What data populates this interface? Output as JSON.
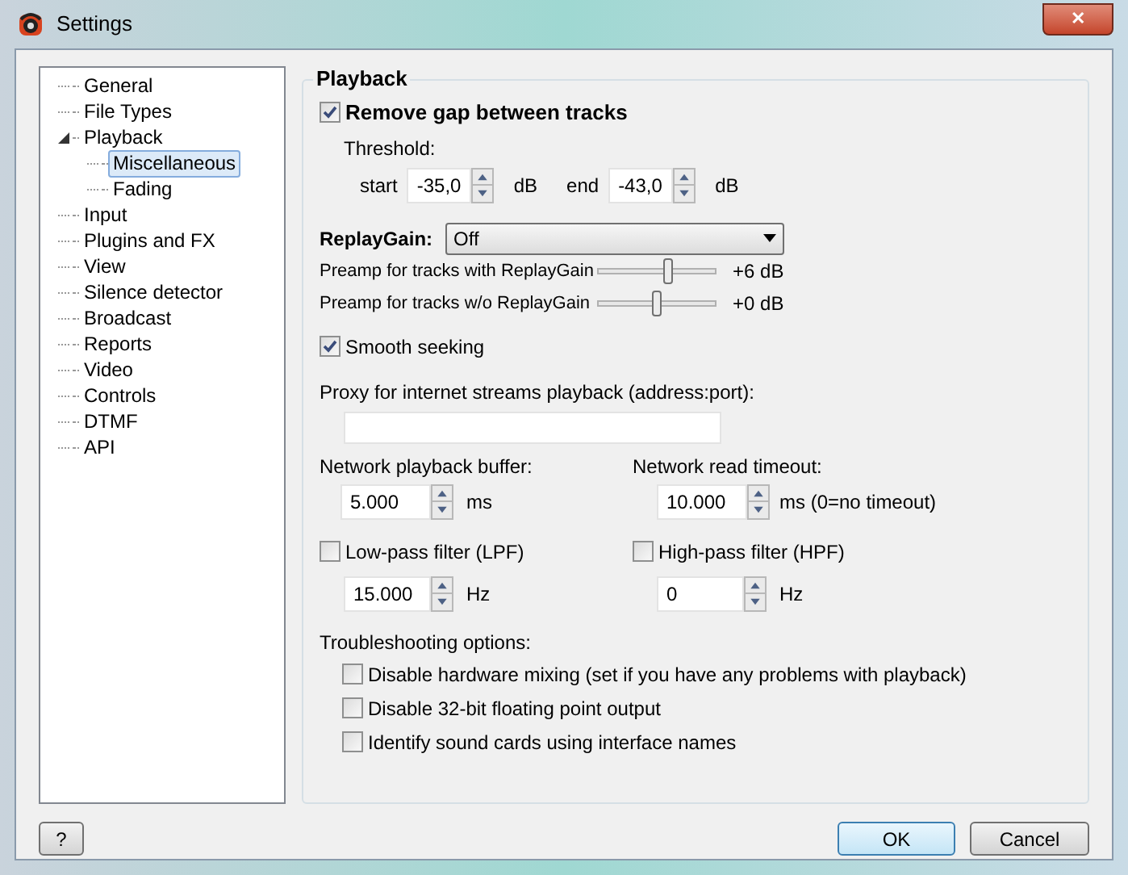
{
  "window": {
    "title": "Settings",
    "close": "✕"
  },
  "tree": [
    {
      "label": "General",
      "selected": false
    },
    {
      "label": "File Types",
      "selected": false
    },
    {
      "label": "Playback",
      "selected": false,
      "expanded": true,
      "children": [
        {
          "label": "Miscellaneous",
          "selected": true
        },
        {
          "label": "Fading",
          "selected": false
        }
      ]
    },
    {
      "label": "Input",
      "selected": false
    },
    {
      "label": "Plugins and FX",
      "selected": false
    },
    {
      "label": "View",
      "selected": false
    },
    {
      "label": "Silence detector",
      "selected": false
    },
    {
      "label": "Broadcast",
      "selected": false
    },
    {
      "label": "Reports",
      "selected": false
    },
    {
      "label": "Video",
      "selected": false
    },
    {
      "label": "Controls",
      "selected": false
    },
    {
      "label": "DTMF",
      "selected": false
    },
    {
      "label": "API",
      "selected": false
    }
  ],
  "group": {
    "title": "Playback",
    "remove_gap": {
      "label": "Remove gap between tracks",
      "checked": true
    },
    "threshold": {
      "label": "Threshold:",
      "start": {
        "label": "start",
        "value": "-35,0",
        "unit": "dB"
      },
      "end": {
        "label": "end",
        "value": "-43,0",
        "unit": "dB"
      }
    },
    "replaygain": {
      "label": "ReplayGain:",
      "value": "Off"
    },
    "preamps": [
      {
        "label": "Preamp for tracks with ReplayGain",
        "level": 0.6,
        "reading": "+6 dB"
      },
      {
        "label": "Preamp for tracks w/o ReplayGain",
        "level": 0.5,
        "reading": "+0 dB"
      }
    ],
    "smooth_seeking": {
      "label": "Smooth seeking",
      "checked": true
    },
    "proxy": {
      "label": "Proxy for internet streams playback (address:port):"
    },
    "buffer": {
      "label": "Network playback buffer:",
      "value": "5.000",
      "unit": "ms"
    },
    "timeout": {
      "label": "Network read timeout:",
      "value": "10.000",
      "unit": "ms (0=no timeout)"
    },
    "lpf": {
      "label": "Low-pass filter (LPF)",
      "checked": false,
      "value": "15.000",
      "unit": "Hz"
    },
    "hpf": {
      "label": "High-pass filter (HPF)",
      "checked": false,
      "value": "0",
      "unit": "Hz"
    },
    "troubleshooting": {
      "label": "Troubleshooting options:",
      "options": [
        {
          "label": "Disable hardware mixing (set if you have any problems with playback)",
          "checked": false
        },
        {
          "label": "Disable 32-bit floating point output",
          "checked": false
        },
        {
          "label": "Identify sound cards using interface names",
          "checked": false
        }
      ]
    }
  },
  "buttons": {
    "help": "?",
    "ok": "OK",
    "cancel": "Cancel"
  }
}
